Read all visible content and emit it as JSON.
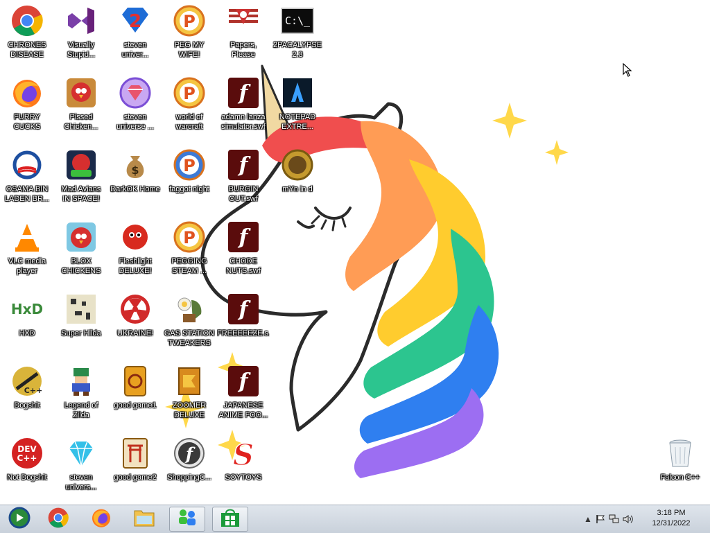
{
  "desktop": {
    "icons": [
      {
        "label": "CHRONES\nDISEASE",
        "icon": "chrome-icon"
      },
      {
        "label": "Visually\nStupid...",
        "icon": "visual-studio-icon"
      },
      {
        "label": "steven\nuniver...",
        "icon": "steven-universe-2-icon"
      },
      {
        "label": "PEG MY WIFE!",
        "icon": "peggle-icon"
      },
      {
        "label": "Papers,\nPlease",
        "icon": "papers-please-icon"
      },
      {
        "label": "2PACALYPSE\n2.3",
        "icon": "command-prompt-icon"
      },
      {
        "label": "FURRY CUCKS",
        "icon": "firefox-icon"
      },
      {
        "label": "Pissed\nChicken...",
        "icon": "angry-birds-seasons-icon"
      },
      {
        "label": "steven\nuniverse ...",
        "icon": "gem-icon"
      },
      {
        "label": "world of\nwarcraft",
        "icon": "peggle-icon"
      },
      {
        "label": "adamn lanza\nsimulator.swf",
        "icon": "flash-icon"
      },
      {
        "label": "NOTEPAD\nEXTRE...",
        "icon": "notepad-extreme-icon"
      },
      {
        "label": "OSAMA BIN\nLADEN BR...",
        "icon": "obama-logo-icon"
      },
      {
        "label": "Mad Avians\nIN SPACE!",
        "icon": "angry-birds-space-icon"
      },
      {
        "label": "DarkOK Home",
        "icon": "money-bag-icon"
      },
      {
        "label": "faggot night",
        "icon": "peggle-nights-icon"
      },
      {
        "label": "BURGIN\nOUT.swf",
        "icon": "flash-icon"
      },
      {
        "label": "mYn in d",
        "icon": "gold-coin-icon"
      },
      {
        "label": "VLC media\nplayer",
        "icon": "vlc-icon"
      },
      {
        "label": "BLOX\nCHICKENS",
        "icon": "angry-birds-icon"
      },
      {
        "label": "Fleshlight\nDELUXE!",
        "icon": "red-fuzzball-icon"
      },
      {
        "label": "PEGGING\nSTEAM ...",
        "icon": "peggle-icon"
      },
      {
        "label": "CHODE\nNUTS.swf",
        "icon": "flash-icon"
      },
      {
        "label": "HXD",
        "icon": "hxd-icon"
      },
      {
        "label": "Super Hilda",
        "icon": "pixel-art-icon"
      },
      {
        "label": "UKRAINE!",
        "icon": "radiation-icon"
      },
      {
        "label": "GAS STATION\nTWEAKERS",
        "icon": "plants-zombies-icon"
      },
      {
        "label": "FREEEEEZE.s...",
        "icon": "flash-icon"
      },
      {
        "label": "Dogshit",
        "icon": "codeblocks-icon"
      },
      {
        "label": "Legend of\nZilda",
        "icon": "pixel-character-icon"
      },
      {
        "label": "good game1",
        "icon": "mahjong-tile-icon"
      },
      {
        "label": "ZOOMER\nDELUXE",
        "icon": "zuma-icon"
      },
      {
        "label": "JAPANESE\nANIME FOO...",
        "icon": "flash-icon"
      },
      {
        "label": "Not Dogshit",
        "icon": "dev-cpp-icon"
      },
      {
        "label": "steven\nunivers...",
        "icon": "diamond-icon"
      },
      {
        "label": "good game2",
        "icon": "mahjong-torii-icon"
      },
      {
        "label": "ShoppingC...",
        "icon": "flash-player-icon"
      },
      {
        "label": "SOYTOYS",
        "icon": "red-s-icon"
      },
      {
        "label": "Falcon C++",
        "icon": "recycle-bin-icon"
      }
    ],
    "glyphs": {
      "flash": "f",
      "cmd": "C:\\_",
      "devcpp_top": "DEV",
      "devcpp_bottom": "C++",
      "hxd": "HxD",
      "s": "S",
      "dollar": "$",
      "p": "P",
      "two": "2"
    }
  },
  "taskbar": {
    "buttons": [
      {
        "name": "media-center-taskbar-button",
        "icon": "windows-media-center-icon"
      },
      {
        "name": "chrome-taskbar-button",
        "icon": "chrome-icon"
      },
      {
        "name": "firefox-taskbar-button",
        "icon": "firefox-icon"
      },
      {
        "name": "explorer-taskbar-button",
        "icon": "folder-icon"
      },
      {
        "name": "network-taskbar-button",
        "icon": "network-users-icon"
      },
      {
        "name": "store-taskbar-button",
        "icon": "store-icon"
      }
    ],
    "clock": {
      "time": "3:18 PM",
      "date": "12/31/2022"
    },
    "tray": [
      "show-hidden-icons-chevron",
      "action-center-flag-icon",
      "network-icon",
      "volume-icon"
    ]
  },
  "colors": {
    "taskbar_top": "#dfe5ec",
    "taskbar_bottom": "#c9d1db",
    "flash_bg": "#5a0c0c",
    "mane": [
      "#f04e4e",
      "#ff9c55",
      "#ffcc2e",
      "#2cc58f",
      "#2f7ff0",
      "#9c6ef2"
    ],
    "sparkle": "#ffd84a"
  }
}
